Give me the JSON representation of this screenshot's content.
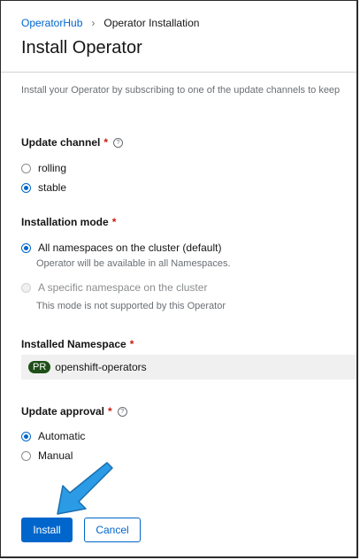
{
  "breadcrumb": {
    "parent": "OperatorHub",
    "separator": "›",
    "current": "Operator Installation"
  },
  "page_title": "Install Operator",
  "intro": "Install your Operator by subscribing to one of the update channels to keep",
  "update_channel": {
    "label": "Update channel",
    "required": "*",
    "help": "?",
    "options": [
      "rolling",
      "stable"
    ],
    "selected": "stable"
  },
  "installation_mode": {
    "label": "Installation mode",
    "required": "*",
    "all_namespaces_label": "All namespaces on the cluster (default)",
    "all_namespaces_desc": "Operator will be available in all Namespaces.",
    "specific_label": "A specific namespace on the cluster",
    "specific_desc": "This mode is not supported by this Operator",
    "selected": "All namespaces on the cluster (default)"
  },
  "installed_namespace": {
    "label": "Installed Namespace",
    "required": "*",
    "badge": "PR",
    "value": "openshift-operators"
  },
  "update_approval": {
    "label": "Update approval",
    "required": "*",
    "help": "?",
    "options": [
      "Automatic",
      "Manual"
    ],
    "selected": "Automatic"
  },
  "actions": {
    "install": "Install",
    "cancel": "Cancel"
  },
  "colors": {
    "primary": "#0066cc",
    "required": "#c9190b",
    "annotation_arrow": "#2b9be6",
    "badge": "#1e4f18"
  }
}
